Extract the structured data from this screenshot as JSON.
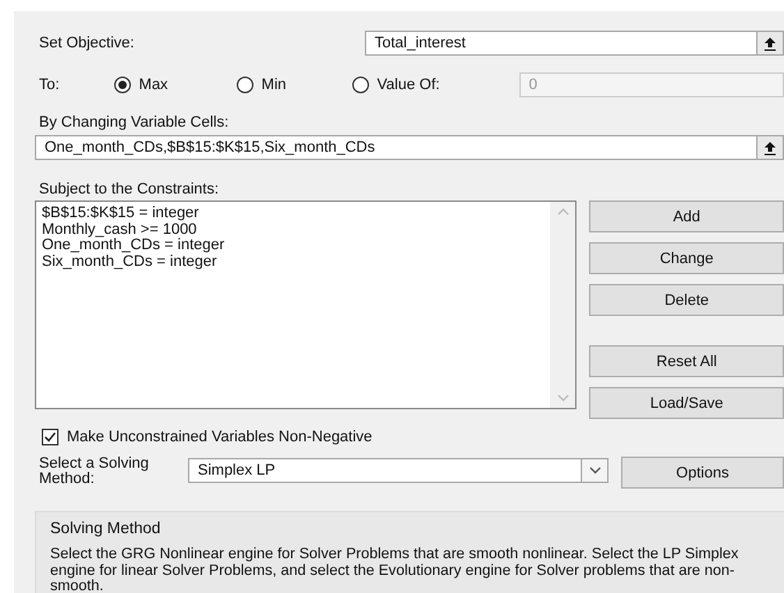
{
  "objective": {
    "label": "Set Objective:",
    "value": "Total_interest"
  },
  "to": {
    "label": "To:",
    "options": [
      {
        "label": "Max",
        "selected": true
      },
      {
        "label": "Min",
        "selected": false
      },
      {
        "label": "Value Of:",
        "selected": false
      }
    ],
    "value_field": {
      "value": "0",
      "disabled": true
    }
  },
  "changing": {
    "label": "By Changing Variable Cells:",
    "value": "One_month_CDs,$B$15:$K$15,Six_month_CDs"
  },
  "constraints": {
    "label": "Subject to the Constraints:",
    "items": [
      "$B$15:$K$15 = integer",
      "Monthly_cash >= 1000",
      "One_month_CDs = integer",
      "Six_month_CDs = integer"
    ]
  },
  "buttons": [
    "Add",
    "Change",
    "Delete",
    "Reset All",
    "Load/Save"
  ],
  "non_negative": {
    "label": "Make Unconstrained Variables Non-Negative",
    "checked": true
  },
  "method": {
    "label": "Select a Solving Method:",
    "value": "Simplex LP"
  },
  "options_button": "Options",
  "description": {
    "title": "Solving Method",
    "text": "Select the GRG Nonlinear engine for Solver Problems that are smooth nonlinear. Select the LP Simplex engine for linear Solver Problems, and select the Evolutionary engine for Solver problems that are non-smooth."
  }
}
